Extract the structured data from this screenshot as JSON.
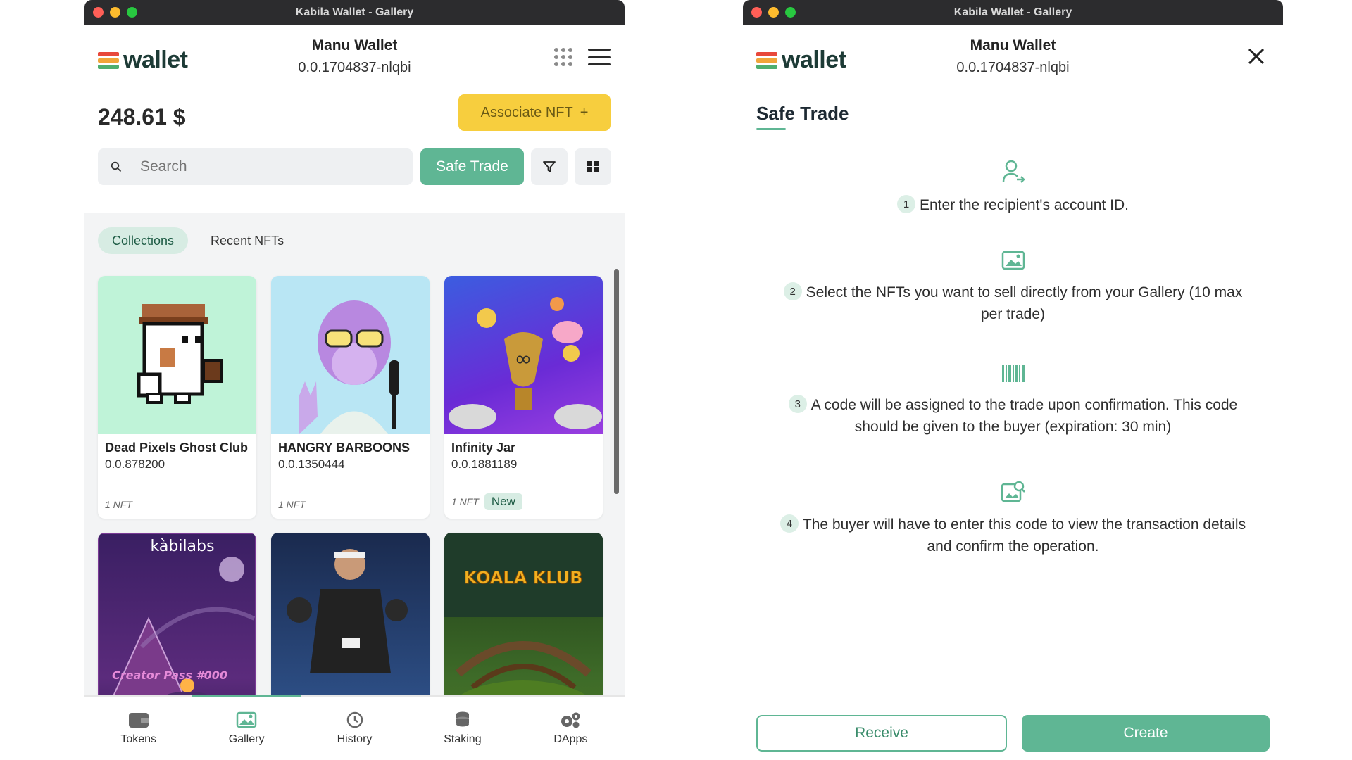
{
  "window": {
    "title": "Kabila Wallet - Gallery"
  },
  "brand": {
    "logo_text": "wallet",
    "colors": {
      "accent": "#5fb694",
      "associate": "#f7ce3e",
      "logo_red": "#e8483b",
      "logo_orange": "#f0a53a",
      "logo_green": "#4fae6f"
    }
  },
  "account": {
    "name": "Manu Wallet",
    "id": "0.0.1704837-nlqbi"
  },
  "gallery": {
    "balance": "248.61 $",
    "associate_label": "Associate NFT",
    "associate_icon": "+",
    "search_placeholder": "Search",
    "safe_trade_label": "Safe Trade",
    "tabs": [
      {
        "label": "Collections",
        "active": true
      },
      {
        "label": "Recent NFTs",
        "active": false
      }
    ],
    "cards": [
      {
        "name": "Dead Pixels Ghost Club",
        "id": "0.0.878200",
        "count": "1 NFT",
        "badge": ""
      },
      {
        "name": "HANGRY BARBOONS",
        "id": "0.0.1350444",
        "count": "1 NFT",
        "badge": ""
      },
      {
        "name": "Infinity Jar",
        "id": "0.0.1881189",
        "count": "1 NFT",
        "badge": "New"
      },
      {
        "name": "",
        "id": "",
        "count": "",
        "badge": "",
        "art_text": "kàbilabs",
        "art_caption": "Creator Pass #000"
      },
      {
        "name": "",
        "id": "",
        "count": "",
        "badge": ""
      },
      {
        "name": "",
        "id": "",
        "count": "",
        "badge": "",
        "art_text": "KOALA KLUB"
      }
    ],
    "nav": [
      {
        "label": "Tokens",
        "icon": "wallet-icon",
        "active": false
      },
      {
        "label": "Gallery",
        "icon": "image-icon",
        "active": true
      },
      {
        "label": "History",
        "icon": "history-icon",
        "active": false
      },
      {
        "label": "Staking",
        "icon": "coins-stack-icon",
        "active": false
      },
      {
        "label": "DApps",
        "icon": "gears-icon",
        "active": false
      }
    ]
  },
  "trade": {
    "title": "Safe Trade",
    "steps": [
      {
        "num": "1",
        "icon": "user-plus-icon",
        "text": "Enter the recipient's account ID."
      },
      {
        "num": "2",
        "icon": "gallery-image-icon",
        "text": "Select the NFTs you want to sell directly from your Gallery (10 max per trade)"
      },
      {
        "num": "3",
        "icon": "barcode-icon",
        "text": "A code will be assigned to the trade upon confirmation. This code should be given to the buyer (expiration: 30 min)"
      },
      {
        "num": "4",
        "icon": "image-search-icon",
        "text": "The buyer will have to enter this code to view the transaction details and confirm the operation."
      }
    ],
    "receive_label": "Receive",
    "create_label": "Create"
  }
}
